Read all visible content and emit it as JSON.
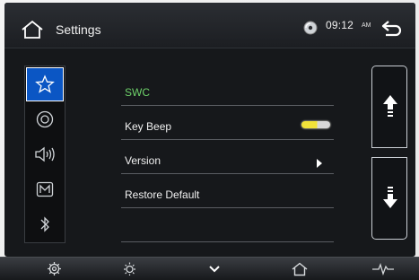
{
  "header": {
    "title": "Settings",
    "time": "09:12",
    "ampm": "AM"
  },
  "icons": {
    "home": "home-icon",
    "disc": "disc-icon",
    "back": "back-arrow-icon",
    "tabs": [
      "star-icon",
      "disc-icon",
      "speaker-icon",
      "m-badge-icon",
      "bluetooth-icon"
    ],
    "bottom": [
      "gear-icon",
      "brightness-icon",
      "chevron-down-icon",
      "home-icon",
      "waveform-icon"
    ]
  },
  "list": {
    "items": [
      {
        "label": "SWC",
        "highlighted": true
      },
      {
        "label": "Key Beep",
        "control": "toggle",
        "state": "on"
      },
      {
        "label": "Version",
        "control": "chevron"
      },
      {
        "label": "Restore Default"
      }
    ]
  },
  "colors": {
    "accent_blue": "#0b56c4",
    "swc_green": "#6ed26a",
    "toggle_on": "#f1e23a"
  }
}
